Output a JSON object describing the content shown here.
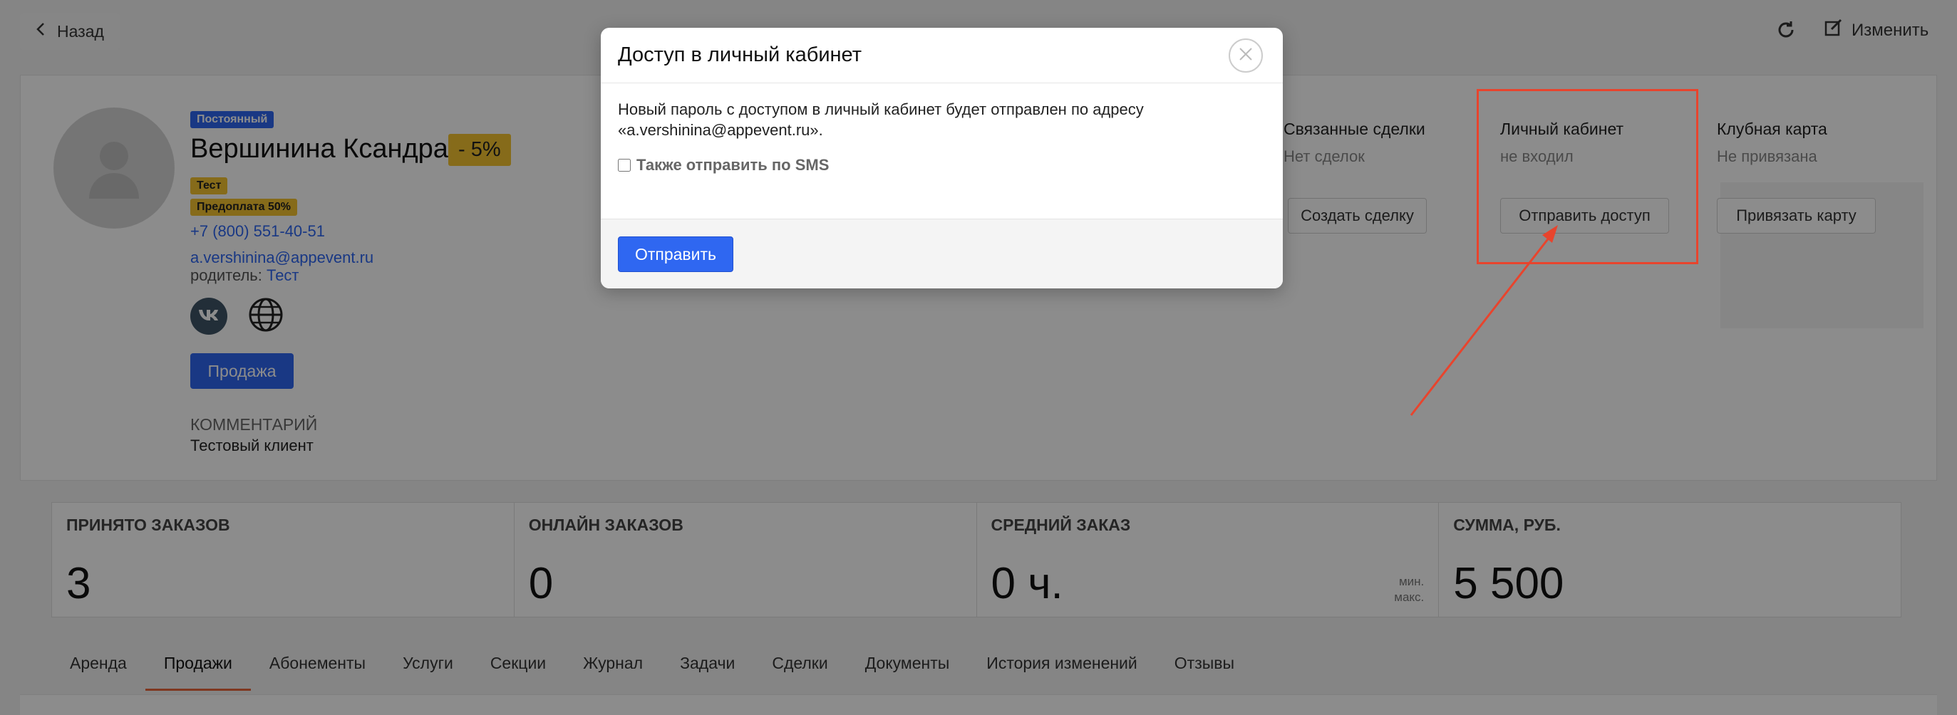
{
  "topbar": {
    "back_label": "Назад",
    "edit_label": "Изменить"
  },
  "profile": {
    "status_badge": "Постоянный",
    "name": "Вершинина Ксандра",
    "discount": "- 5%",
    "tags": [
      "Тест",
      "Предоплата 50%"
    ],
    "phone": "+7 (800) 551-40-51",
    "email": "a.vershinina@appevent.ru",
    "parent_label": "родитель:",
    "parent_value": "Тест",
    "sale_button": "Продажа",
    "comment_title": "КОММЕНТАРИЙ",
    "comment_text": "Тестовый клиент"
  },
  "related_deals": {
    "title": "Связанные сделки",
    "value": "Нет сделок",
    "button": "Создать сделку"
  },
  "personal_cabinet": {
    "title": "Личный кабинет",
    "value": "не входил",
    "button": "Отправить доступ"
  },
  "club_card": {
    "title": "Клубная карта",
    "value": "Не привязана",
    "button": "Привязать карту"
  },
  "stats": [
    {
      "label": "ПРИНЯТО ЗАКАЗОВ",
      "value": "3"
    },
    {
      "label": "ОНЛАЙН ЗАКАЗОВ",
      "value": "0"
    },
    {
      "label": "СРЕДНИЙ ЗАКАЗ",
      "value": "0 ч.",
      "min_label": "мин.",
      "max_label": "макс."
    },
    {
      "label": "СУММА, РУБ.",
      "value": "5 500"
    }
  ],
  "tabs": [
    "Аренда",
    "Продажи",
    "Абонементы",
    "Услуги",
    "Секции",
    "Журнал",
    "Задачи",
    "Сделки",
    "Документы",
    "История изменений",
    "Отзывы"
  ],
  "active_tab": "Продажи",
  "modal": {
    "title": "Доступ в личный кабинет",
    "body_line1": "Новый пароль с доступом в личный кабинет будет отправлен по адресу",
    "body_line2": "«a.vershinina@appevent.ru».",
    "sms_checkbox_label": "Также отправить по SMS",
    "sms_checked": false,
    "send_button": "Отправить"
  },
  "colors": {
    "accent_blue": "#2f67f1",
    "badge_yellow": "#f4c430",
    "annotation_red": "#e8442d",
    "active_tab_underline": "#e8643a"
  }
}
